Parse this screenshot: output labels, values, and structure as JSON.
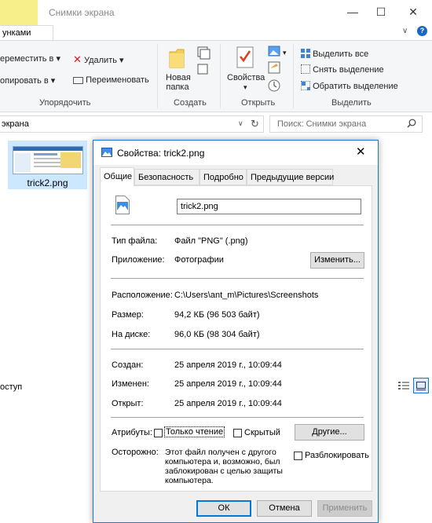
{
  "explorer": {
    "title": "Снимки экрана",
    "active_tab": "унками",
    "window_controls": {
      "minimize": "—",
      "maximize": "☐",
      "close": "✕"
    },
    "ribbon": {
      "organize": {
        "move_to": "ереместить в",
        "copy_to": "опировать в",
        "delete": "Удалить",
        "rename": "Переименовать",
        "group_title": "Упорядочить"
      },
      "create": {
        "new_folder_line1": "Новая",
        "new_folder_line2": "папка",
        "group_title": "Создать"
      },
      "open": {
        "properties": "Свойства",
        "group_title": "Открыть"
      },
      "select": {
        "select_all": "Выделить все",
        "select_none": "Снять выделение",
        "invert": "Обратить выделение",
        "group_title": "Выделить"
      }
    },
    "address": "экрана",
    "search_placeholder": "Поиск: Снимки экрана",
    "file": {
      "name": "trick2.png"
    },
    "status": "оступ"
  },
  "dialog": {
    "title": "Свойства: trick2.png",
    "tabs": [
      "Общие",
      "Безопасность",
      "Подробно",
      "Предыдущие версии"
    ],
    "file_name": "trick2.png",
    "labels": {
      "file_type": "Тип файла:",
      "app": "Приложение:",
      "location": "Расположение:",
      "size": "Размер:",
      "size_on_disk": "На диске:",
      "created": "Создан:",
      "modified": "Изменен:",
      "accessed": "Открыт:",
      "attributes": "Атрибуты:",
      "caution": "Осторожно:"
    },
    "values": {
      "file_type": "Файл \"PNG\" (.png)",
      "app": "Фотографии",
      "location": "C:\\Users\\ant_m\\Pictures\\Screenshots",
      "size": "94,2 КБ (96 503 байт)",
      "size_on_disk": "96,0 КБ (98 304 байт)",
      "created": "25 апреля 2019 г., 10:09:44",
      "modified": "25 апреля 2019 г., 10:09:44",
      "accessed": "25 апреля 2019 г., 10:09:44"
    },
    "buttons": {
      "change": "Изменить...",
      "other": "Другие...",
      "ok": "ОК",
      "cancel": "Отмена",
      "apply": "Применить"
    },
    "attributes": {
      "read_only": "Только чтение",
      "hidden": "Скрытый"
    },
    "caution_text": [
      "Этот файл получен с другого",
      "компьютера и, возможно, был",
      "заблокирован с целью защиты",
      "компьютера."
    ],
    "unblock": "Разблокировать"
  }
}
